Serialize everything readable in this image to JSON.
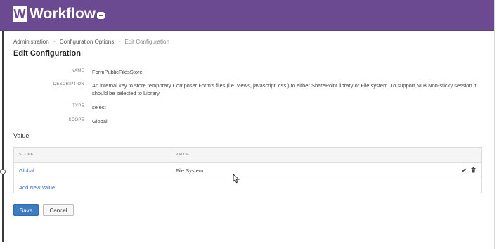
{
  "header": {
    "logo_letter": "W",
    "app_title": "Workflow",
    "menu_icon": "menu-square-icon",
    "background": "#6b4a91"
  },
  "breadcrumb": {
    "items": [
      "Administration",
      "Configuration Options",
      "Edit Configuration"
    ]
  },
  "page_title": "Edit Configuration",
  "properties": {
    "name": {
      "label": "NAME",
      "value": "FormPublicFilesStore"
    },
    "description": {
      "label": "DESCRIPTION",
      "value": "An internal key to store temporary Composer Form's files (i.e. views, javascript, css ) to either SharePoint library or File system. To support NLB Non-sticky session it should be selected to Library."
    },
    "type": {
      "label": "TYPE",
      "value": "select"
    },
    "scope": {
      "label": "SCOPE",
      "value": "Global"
    }
  },
  "value_section": {
    "title": "Value",
    "columns": [
      "SCOPE",
      "VALUE"
    ],
    "rows": [
      {
        "scope": "Global",
        "value": "File System",
        "actions": [
          "edit-icon",
          "trash-icon"
        ]
      }
    ],
    "add_link": "Add New Value"
  },
  "buttons": {
    "save": "Save",
    "cancel": "Cancel"
  },
  "colors": {
    "link": "#3d6fb6",
    "primary_button": "#3f7bc2"
  }
}
